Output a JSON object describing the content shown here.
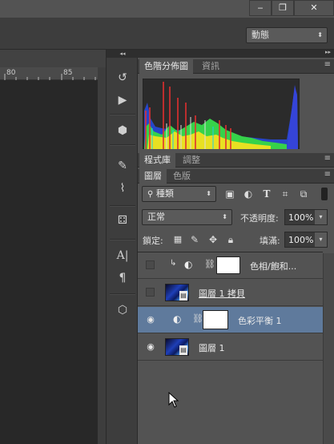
{
  "window": {
    "minimize_icon": "minimize-icon",
    "restore_icon": "restore-icon",
    "close_icon": "close-icon"
  },
  "options_bar": {
    "preset_select": "動態"
  },
  "ruler": {
    "tick1": "80",
    "tick2": "85"
  },
  "histogram_panel": {
    "tabs": [
      "色階分佈圖",
      "資訊"
    ]
  },
  "library_panel": {
    "tabs": [
      "程式庫",
      "調整"
    ]
  },
  "layers_panel": {
    "tabs": [
      "圖層",
      "色版"
    ],
    "filter_select": "種類",
    "blend_mode": "正常",
    "opacity_label": "不透明度:",
    "opacity_value": "100%",
    "lock_label": "鎖定:",
    "fill_label": "填滿:",
    "fill_value": "100%",
    "layers": [
      {
        "name": "色相/飽和...",
        "visible": false,
        "type": "adjustment",
        "clipped": true,
        "selected": false
      },
      {
        "name": "圖層 1 拷貝",
        "visible": false,
        "type": "pixel",
        "selected": false
      },
      {
        "name": "色彩平衡 1",
        "visible": true,
        "type": "adjustment",
        "selected": true
      },
      {
        "name": "圖層 1",
        "visible": true,
        "type": "pixel",
        "selected": false
      }
    ]
  },
  "colors": {
    "selected_layer": "#5f7a9c",
    "panel_bg": "#535353"
  }
}
